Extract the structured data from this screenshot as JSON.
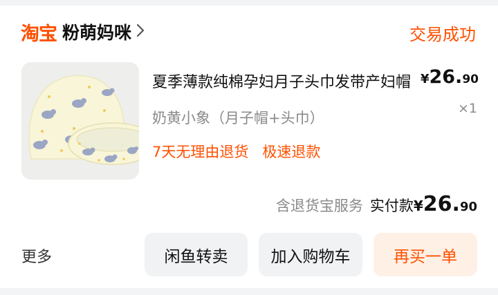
{
  "shop": {
    "platform": "淘宝",
    "name": "粉萌妈咪",
    "chevron_icon": "chevron-right-icon"
  },
  "order_status": "交易成功",
  "item": {
    "title": "夏季薄款纯棉孕妇月子头巾发带产妇帽",
    "price_currency": "¥",
    "price_int": "26.",
    "price_dec": "90",
    "sku": "奶黄小象（月子帽+头巾）",
    "quantity": "×1",
    "tags": [
      "7天无理由退货",
      "极速退款"
    ]
  },
  "payment": {
    "service": "含退货宝服务",
    "label": "实付款",
    "currency": "¥",
    "int": "26.",
    "dec": "90"
  },
  "actions": {
    "more": "更多",
    "resell": "闲鱼转卖",
    "add_to_cart": "加入购物车",
    "buy_again": "再买一单"
  },
  "colors": {
    "accent": "#ff5000",
    "page_bg": "#f2f3f5",
    "muted": "#8a8a8a"
  }
}
